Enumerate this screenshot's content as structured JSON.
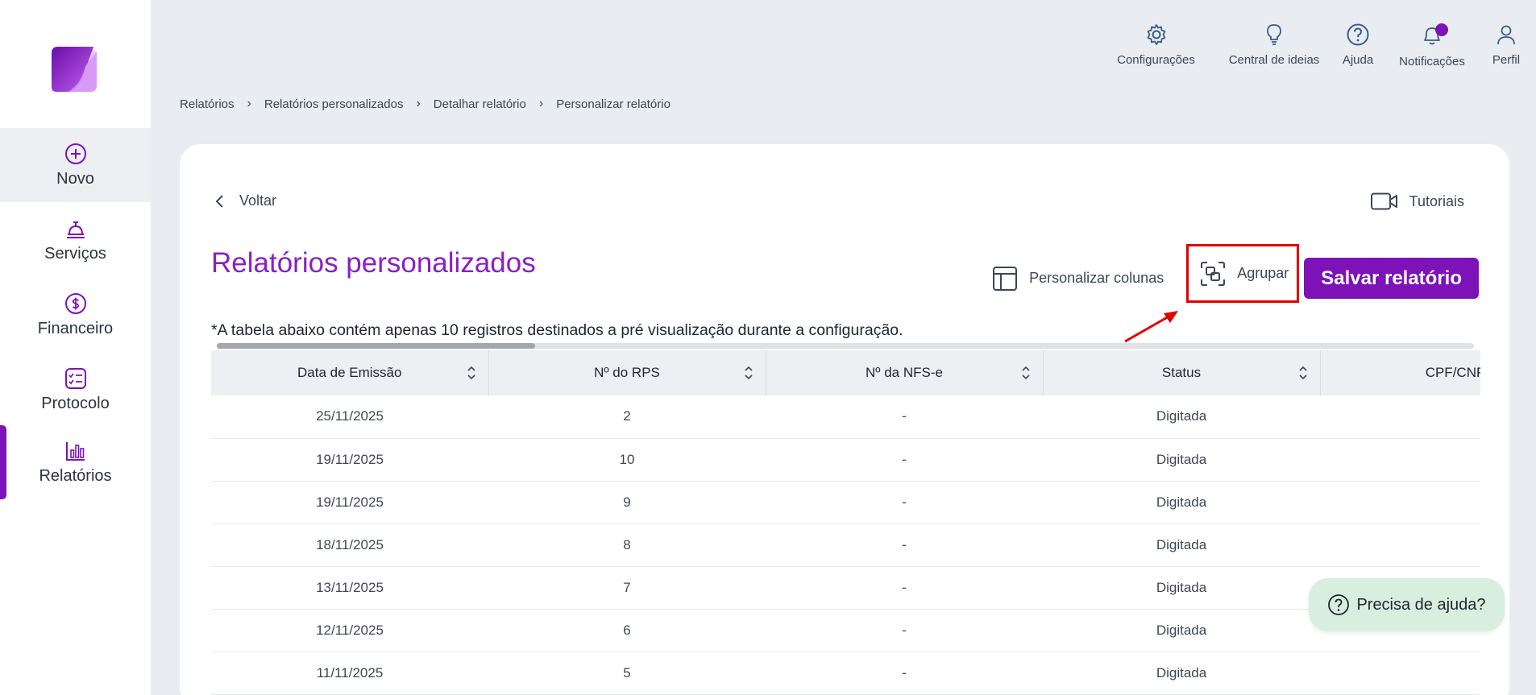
{
  "sidebar": {
    "items": [
      {
        "label": "Novo",
        "icon": "plus-circle-icon"
      },
      {
        "label": "Serviços",
        "icon": "service-bell-icon"
      },
      {
        "label": "Financeiro",
        "icon": "dollar-circle-icon"
      },
      {
        "label": "Protocolo",
        "icon": "checklist-icon"
      },
      {
        "label": "Relatórios",
        "icon": "bar-chart-icon"
      }
    ]
  },
  "topbar": {
    "items": [
      {
        "label": "Configurações",
        "icon": "gear-icon"
      },
      {
        "label": "Central de ideias",
        "icon": "lightbulb-icon"
      },
      {
        "label": "Ajuda",
        "icon": "help-circle-icon"
      },
      {
        "label": "Notificações",
        "icon": "bell-icon"
      },
      {
        "label": "Perfil",
        "icon": "user-icon"
      }
    ]
  },
  "breadcrumb": [
    "Relatórios",
    "Relatórios personalizados",
    "Detalhar relatório",
    "Personalizar relatório"
  ],
  "card": {
    "back_label": "Voltar",
    "tutorials_label": "Tutoriais",
    "title": "Relatórios personalizados",
    "customize_columns_label": "Personalizar colunas",
    "group_label": "Agrupar",
    "save_label": "Salvar relatório",
    "note": "*A tabela abaixo contém apenas 10 registros destinados a pré visualização durante a configuração."
  },
  "table": {
    "columns": [
      "Data de Emissão",
      "Nº do RPS",
      "Nº da NFS-e",
      "Status",
      "CPF/CNPJ"
    ],
    "rows": [
      [
        "25/11/2025",
        "2",
        "-",
        "Digitada",
        ""
      ],
      [
        "19/11/2025",
        "10",
        "-",
        "Digitada",
        ""
      ],
      [
        "19/11/2025",
        "9",
        "-",
        "Digitada",
        ""
      ],
      [
        "18/11/2025",
        "8",
        "-",
        "Digitada",
        ""
      ],
      [
        "13/11/2025",
        "7",
        "-",
        "Digitada",
        ""
      ],
      [
        "12/11/2025",
        "6",
        "-",
        "Digitada",
        ""
      ],
      [
        "11/11/2025",
        "5",
        "-",
        "Digitada",
        ""
      ]
    ]
  },
  "help_button": {
    "label": "Precisa de ajuda?"
  },
  "colors": {
    "accent": "#7d12b8",
    "annotation": "#e30000",
    "help_bg": "#d8eedf"
  }
}
